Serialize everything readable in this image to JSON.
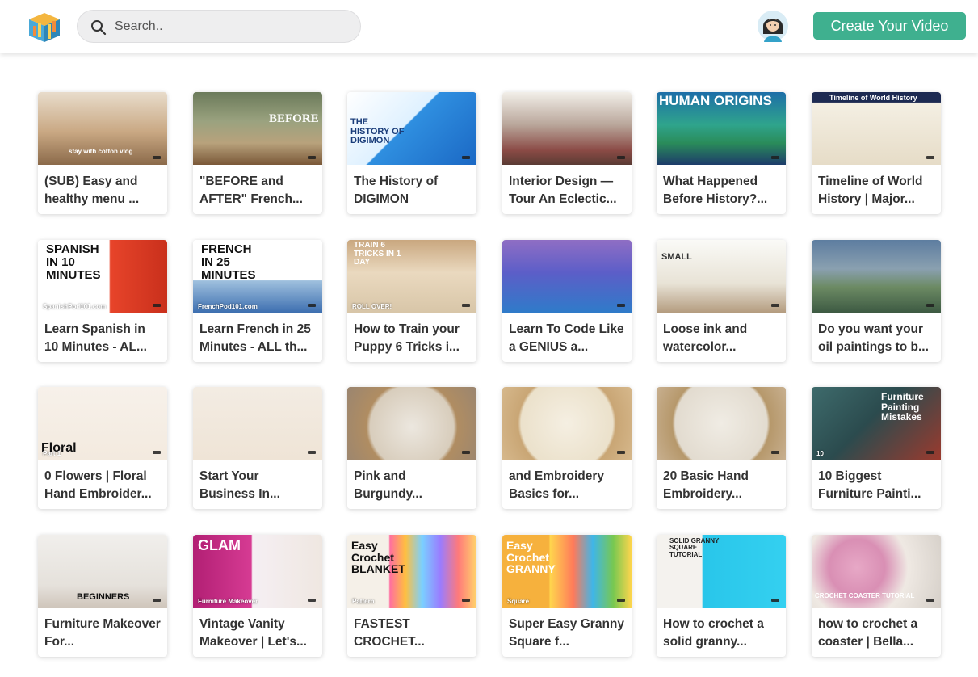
{
  "header": {
    "search_placeholder": "Search..",
    "create_label": "Create Your Video"
  },
  "colors": {
    "accent": "#3fb08f",
    "search_bg": "#eeeeef"
  },
  "videos": [
    {
      "title": "(SUB) Easy and healthy menu ...",
      "thumb_text": "stay with cotton vlog",
      "thumb_style": "kitchen"
    },
    {
      "title": "\"BEFORE and AFTER\" French...",
      "thumb_text": "BEFORE",
      "thumb_style": "desk"
    },
    {
      "title": "The History of DIGIMON",
      "thumb_text": "THE HISTORY OF DIGIMON",
      "thumb_style": "digimon"
    },
    {
      "title": "Interior Design — Tour An Eclectic...",
      "thumb_text": "",
      "thumb_style": "interior"
    },
    {
      "title": "What Happened Before History?...",
      "thumb_text": "HUMAN ORIGINS",
      "thumb_style": "human"
    },
    {
      "title": "Timeline of World History | Major...",
      "thumb_text": "Timeline of World History",
      "thumb_style": "timeline"
    },
    {
      "title": "Learn Spanish in 10 Minutes - AL...",
      "thumb_text": "SPANISH IN 10 MINUTES",
      "thumb_style": "spanish",
      "thumb_sub": "SpanishPod101.com"
    },
    {
      "title": "Learn French in 25 Minutes - ALL th...",
      "thumb_text": "FRENCH IN 25 MINUTES",
      "thumb_style": "french",
      "thumb_sub": "FrenchPod101.com"
    },
    {
      "title": "How to Train your Puppy 6 Tricks i...",
      "thumb_text": "TRAIN 6 TRICKS IN 1 DAY",
      "thumb_style": "puppy",
      "thumb_sub": "ROLL OVER!"
    },
    {
      "title": "Learn To Code Like a GENIUS a...",
      "thumb_text": "",
      "thumb_style": "code"
    },
    {
      "title": "Loose ink and watercolor...",
      "thumb_text": "SMALL",
      "thumb_style": "ink"
    },
    {
      "title": "Do you want your oil paintings to b...",
      "thumb_text": "",
      "thumb_style": "oil"
    },
    {
      "title": "0 Flowers | Floral Hand Embroider...",
      "thumb_text": "Floral",
      "thumb_style": "floral",
      "thumb_sub": "Part 1"
    },
    {
      "title": "Start Your Business In...",
      "thumb_text": "",
      "thumb_style": "vines"
    },
    {
      "title": "Pink and Burgundy...",
      "thumb_text": "",
      "thumb_style": "hoop"
    },
    {
      "title": "and Embroidery Basics for...",
      "thumb_text": "",
      "thumb_style": "leaves"
    },
    {
      "title": "20 Basic Hand Embroidery...",
      "thumb_text": "",
      "thumb_style": "stitches"
    },
    {
      "title": "10 Biggest Furniture Painti...",
      "thumb_text": "Furniture Painting Mistakes",
      "thumb_style": "paint",
      "thumb_sub": "10"
    },
    {
      "title": "Furniture Makeover For...",
      "thumb_text": "BEGINNERS",
      "thumb_style": "makeover"
    },
    {
      "title": "Vintage Vanity Makeover | Let's...",
      "thumb_text": "GLAM",
      "thumb_style": "vanity",
      "thumb_sub": "Furniture Makeover"
    },
    {
      "title": "FASTEST CROCHET...",
      "thumb_text": "Easy Crochet BLANKET",
      "thumb_style": "blanket",
      "thumb_sub": "Pattern"
    },
    {
      "title": "Super Easy Granny Square f...",
      "thumb_text": "Easy Crochet GRANNY",
      "thumb_style": "granny",
      "thumb_sub": "Square"
    },
    {
      "title": "How to crochet a solid granny...",
      "thumb_text": "SOLID GRANNY SQUARE TUTORIAL",
      "thumb_style": "solid"
    },
    {
      "title": "how to crochet a coaster | Bella...",
      "thumb_text": "CROCHET COASTER TUTORIAL",
      "thumb_style": "coaster"
    }
  ]
}
